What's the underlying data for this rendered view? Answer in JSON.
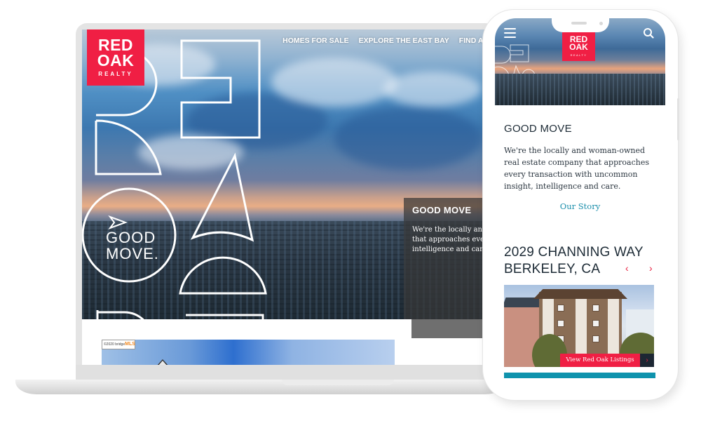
{
  "brand": {
    "logo_line1": "RED",
    "logo_line2": "OAK",
    "logo_line3": "REALTY",
    "accent_red": "#f01f44",
    "link_teal": "#1a8eab",
    "teal_bar": "#0f93ad",
    "navy_text": "#1d2b36"
  },
  "desktop": {
    "nav": [
      {
        "label": "HOMES FOR SALE"
      },
      {
        "label": "EXPLORE THE EAST BAY"
      },
      {
        "label": "FIND AN"
      }
    ],
    "hero_badge_line1": "GOOD",
    "hero_badge_line2": "MOVE.",
    "panel": {
      "title": "GOOD MOVE",
      "lines": [
        "We're the locally and w",
        "that approaches every",
        "intelligence and care."
      ]
    },
    "mls_badge": {
      "prefix": "©2020 bridge",
      "brand": "MLS"
    }
  },
  "mobile": {
    "menu_icon": "hamburger-icon",
    "search_icon": "search-icon",
    "section_title": "GOOD MOVE",
    "section_text": "We're the locally and woman-owned real estate company that approaches every transaction with uncommon insight, intelligence and care.",
    "story_link": "Our Story",
    "listing": {
      "address_line1": "2029 CHANNING WAY",
      "address_line2": "BERKELEY, CA",
      "prev": "‹",
      "next": "›",
      "button_label": "View Red Oak Listings",
      "button_arrow": "›"
    }
  }
}
